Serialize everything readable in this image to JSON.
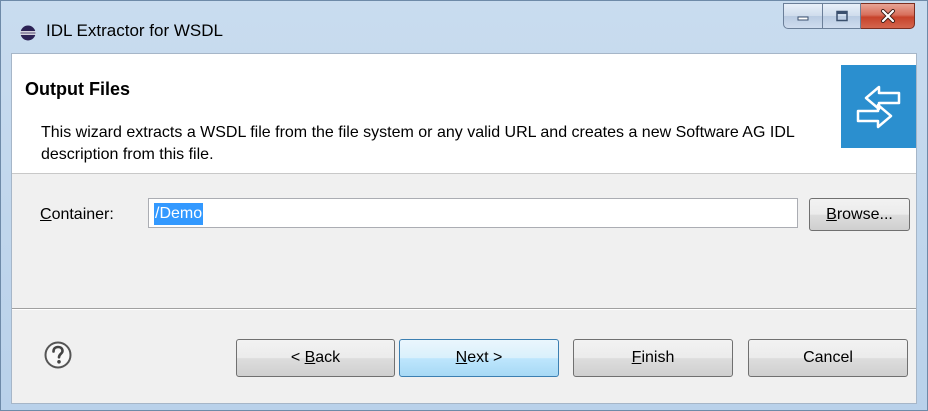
{
  "window": {
    "title": "IDL Extractor for WSDL",
    "icons": {
      "app": "eclipse-icon",
      "minimize": "minimize-icon",
      "maximize": "maximize-icon",
      "close": "close-icon"
    }
  },
  "banner": {
    "title": "Output Files",
    "description": "This wizard extracts a WSDL file from the file system or any valid URL and creates a new Software AG IDL description from this file.",
    "image_icon": "arrows-exchange-icon",
    "image_color": "#2b8fcf"
  },
  "container": {
    "label_mnemonic": "C",
    "label_rest": "ontainer:",
    "value": "/Demo",
    "browse_mnemonic": "B",
    "browse_rest": "rowse..."
  },
  "footer": {
    "help_icon": "help-icon",
    "back_prefix": "< ",
    "back_mnemonic": "B",
    "back_rest": "ack",
    "next_mnemonic": "N",
    "next_rest": "ext >",
    "finish_mnemonic": "F",
    "finish_rest": "inish",
    "cancel": "Cancel"
  }
}
